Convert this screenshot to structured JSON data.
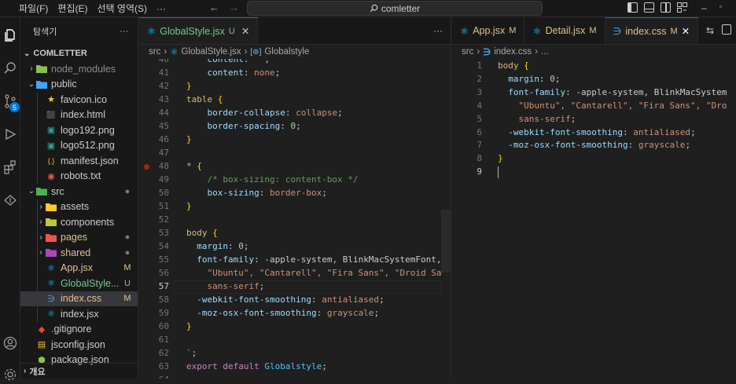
{
  "menu": {
    "items": [
      "파일(F)",
      "편집(E)",
      "선택 영역(S)",
      "···"
    ],
    "search_text": "comletter"
  },
  "sidebar": {
    "title": "탐색기",
    "more": "···",
    "root": "COMLETTER",
    "items": [
      {
        "label": "node_modules",
        "depth": 1,
        "chev": "›",
        "icon": "node-folder-icon",
        "icon_color": "#8bc34a",
        "status": "",
        "label_color": "#8c8c8c"
      },
      {
        "label": "public",
        "depth": 1,
        "chev": "⌄",
        "icon": "public-folder-icon",
        "icon_color": "#42a5f5",
        "status": "",
        "label_color": "#cccccc"
      },
      {
        "label": "favicon.ico",
        "depth": 2,
        "chev": "",
        "icon": "star-icon",
        "icon_color": "#ffca28",
        "status": "",
        "label_color": "#cccccc"
      },
      {
        "label": "index.html",
        "depth": 2,
        "chev": "",
        "icon": "html-icon",
        "icon_color": "#e44d26",
        "status": "",
        "label_color": "#cccccc"
      },
      {
        "label": "logo192.png",
        "depth": 2,
        "chev": "",
        "icon": "image-icon",
        "icon_color": "#26a69a",
        "status": "",
        "label_color": "#cccccc"
      },
      {
        "label": "logo512.png",
        "depth": 2,
        "chev": "",
        "icon": "image-icon",
        "icon_color": "#26a69a",
        "status": "",
        "label_color": "#cccccc"
      },
      {
        "label": "manifest.json",
        "depth": 2,
        "chev": "",
        "icon": "json-braces-icon",
        "icon_color": "#fbc02d",
        "status": "",
        "label_color": "#cccccc"
      },
      {
        "label": "robots.txt",
        "depth": 2,
        "chev": "",
        "icon": "robot-icon",
        "icon_color": "#ef5350",
        "status": "",
        "label_color": "#cccccc"
      },
      {
        "label": "src",
        "depth": 1,
        "chev": "⌄",
        "icon": "src-folder-icon",
        "icon_color": "#4caf50",
        "status": "●",
        "label_color": "#cccccc"
      },
      {
        "label": "assets",
        "depth": 2,
        "chev": "›",
        "icon": "assets-folder-icon",
        "icon_color": "#ffca28",
        "status": "",
        "label_color": "#cccccc"
      },
      {
        "label": "components",
        "depth": 2,
        "chev": "›",
        "icon": "components-folder-icon",
        "icon_color": "#c0ca33",
        "status": "",
        "label_color": "#cccccc"
      },
      {
        "label": "pages",
        "depth": 2,
        "chev": "›",
        "icon": "pages-folder-icon",
        "icon_color": "#ef5350",
        "status": "●",
        "label_color": "#e2c08d"
      },
      {
        "label": "shared",
        "depth": 2,
        "chev": "›",
        "icon": "shared-folder-icon",
        "icon_color": "#ab47bc",
        "status": "●",
        "label_color": "#e2c08d"
      },
      {
        "label": "App.jsx",
        "depth": 2,
        "chev": "",
        "icon": "react-icon",
        "icon_color": "#00d8ff",
        "status": "M",
        "label_color": "#e2c08d"
      },
      {
        "label": "GlobalStyle...",
        "depth": 2,
        "chev": "",
        "icon": "react-icon",
        "icon_color": "#00d8ff",
        "status": "U",
        "label_color": "#73c991"
      },
      {
        "label": "index.css",
        "depth": 2,
        "chev": "",
        "icon": "css-icon",
        "icon_color": "#42a5f5",
        "status": "M",
        "label_color": "#e2c08d",
        "selected": true
      },
      {
        "label": "index.jsx",
        "depth": 2,
        "chev": "",
        "icon": "react-icon",
        "icon_color": "#00d8ff",
        "status": "",
        "label_color": "#cccccc"
      },
      {
        "label": ".gitignore",
        "depth": 1,
        "chev": "",
        "icon": "git-icon",
        "icon_color": "#e64a19",
        "status": "",
        "label_color": "#cccccc"
      },
      {
        "label": "jsconfig.json",
        "depth": 1,
        "chev": "",
        "icon": "jsconfig-icon",
        "icon_color": "#fbc02d",
        "status": "",
        "label_color": "#cccccc"
      },
      {
        "label": "package.json",
        "depth": 1,
        "chev": "",
        "icon": "npm-icon",
        "icon_color": "#8bc34a",
        "status": "",
        "label_color": "#cccccc"
      }
    ],
    "outline": "개요",
    "activity_badge": "5"
  },
  "editor_left": {
    "tab_label": "GlobalStyle.jsx",
    "tab_status": "U",
    "more": "···",
    "breadcrumb": [
      "src",
      "GlobalStyle.jsx",
      "Globalstyle"
    ],
    "lines": [
      {
        "n": "40",
        "t": "    content: \"\";",
        "cls": "w"
      },
      {
        "n": "41",
        "t": "    content: none;"
      },
      {
        "n": "42",
        "t": "}"
      },
      {
        "n": "43",
        "t": "table {"
      },
      {
        "n": "44",
        "t": "    border-collapse: collapse;"
      },
      {
        "n": "45",
        "t": "    border-spacing: 0;"
      },
      {
        "n": "46",
        "t": "}"
      },
      {
        "n": "47",
        "t": ""
      },
      {
        "n": "48",
        "t": "*{"
      },
      {
        "n": "49",
        "t": "    /* box-sizing: content-box */"
      },
      {
        "n": "50",
        "t": "    box-sizing: border-box;"
      },
      {
        "n": "51",
        "t": "}"
      },
      {
        "n": "52",
        "t": ""
      },
      {
        "n": "53",
        "t": "body {"
      },
      {
        "n": "54",
        "t": "  margin: 0;"
      },
      {
        "n": "55",
        "t": "  font-family: -apple-system, BlinkMacSystemFont,"
      },
      {
        "n": "56",
        "t": "    \"Ubuntu\", \"Cantarell\", \"Fira Sans\", \"Droid Sa"
      },
      {
        "n": "57",
        "t": "    sans-serif;"
      },
      {
        "n": "58",
        "t": "  -webkit-font-smoothing: antialiased;"
      },
      {
        "n": "59",
        "t": "  -moz-osx-font-smoothing: grayscale;"
      },
      {
        "n": "60",
        "t": "}"
      },
      {
        "n": "61",
        "t": ""
      },
      {
        "n": "62",
        "t": "`;"
      },
      {
        "n": "63",
        "t": "export default Globalstyle;"
      },
      {
        "n": "64",
        "t": ""
      }
    ]
  },
  "editor_right": {
    "tabs": [
      {
        "label": "App.jsx",
        "status": "M",
        "icon": "react-icon"
      },
      {
        "label": "Detail.jsx",
        "status": "M",
        "icon": "react-icon"
      },
      {
        "label": "index.css",
        "status": "M",
        "icon": "css-icon",
        "active": true
      }
    ],
    "breadcrumb": [
      "src",
      "index.css",
      "..."
    ],
    "lines": [
      {
        "n": "1",
        "t": "body {"
      },
      {
        "n": "2",
        "t": "  margin: 0;"
      },
      {
        "n": "3",
        "t": "  font-family: -apple-system, BlinkMacSystem"
      },
      {
        "n": "4",
        "t": "    \"Ubuntu\", \"Cantarell\", \"Fira Sans\", \"Dro"
      },
      {
        "n": "5",
        "t": "    sans-serif;"
      },
      {
        "n": "6",
        "t": "  -webkit-font-smoothing: antialiased;"
      },
      {
        "n": "7",
        "t": "  -moz-osx-font-smoothing: grayscale;"
      },
      {
        "n": "8",
        "t": "}"
      },
      {
        "n": "9",
        "t": ""
      }
    ]
  },
  "colors": {
    "accent": "#0078d4",
    "modified": "#e2c08d",
    "untracked": "#73c991"
  }
}
